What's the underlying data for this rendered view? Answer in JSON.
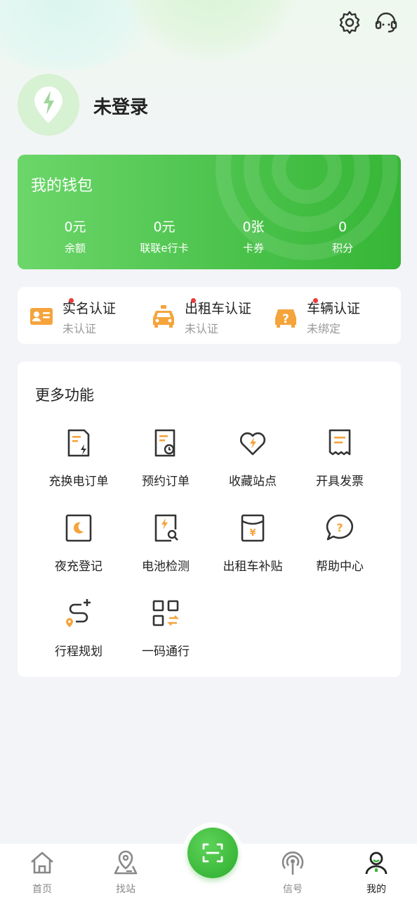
{
  "user": {
    "name": "未登录"
  },
  "wallet": {
    "title": "我的钱包",
    "stats": [
      {
        "value": "0元",
        "label": "余额"
      },
      {
        "value": "0元",
        "label": "联联e行卡"
      },
      {
        "value": "0张",
        "label": "卡券"
      },
      {
        "value": "0",
        "label": "积分"
      }
    ]
  },
  "certifications": [
    {
      "title": "实名认证",
      "status": "未认证",
      "icon": "id-card-icon"
    },
    {
      "title": "出租车认证",
      "status": "未认证",
      "icon": "taxi-icon"
    },
    {
      "title": "车辆认证",
      "status": "未绑定",
      "icon": "car-question-icon"
    }
  ],
  "more_functions": {
    "title": "更多功能",
    "items": [
      {
        "label": "充换电订单",
        "icon": "charge-order-icon"
      },
      {
        "label": "预约订单",
        "icon": "reservation-order-icon"
      },
      {
        "label": "收藏站点",
        "icon": "favorite-station-icon"
      },
      {
        "label": "开具发票",
        "icon": "invoice-icon"
      },
      {
        "label": "夜充登记",
        "icon": "night-charge-icon"
      },
      {
        "label": "电池检测",
        "icon": "battery-check-icon"
      },
      {
        "label": "出租车补贴",
        "icon": "taxi-subsidy-icon"
      },
      {
        "label": "帮助中心",
        "icon": "help-center-icon"
      },
      {
        "label": "行程规划",
        "icon": "route-plan-icon"
      },
      {
        "label": "一码通行",
        "icon": "qr-pass-icon"
      }
    ]
  },
  "tabbar": {
    "items": [
      {
        "label": "首页",
        "icon": "home-icon"
      },
      {
        "label": "找站",
        "icon": "map-pin-icon"
      },
      {
        "label": "信号",
        "icon": "signal-icon"
      },
      {
        "label": "我的",
        "icon": "profile-icon"
      }
    ],
    "scan_icon": "scan-icon",
    "active": "我的"
  },
  "colors": {
    "accent_green": "#3bb839",
    "icon_orange": "#f5a43c",
    "badge_red": "#ea3b3b"
  }
}
